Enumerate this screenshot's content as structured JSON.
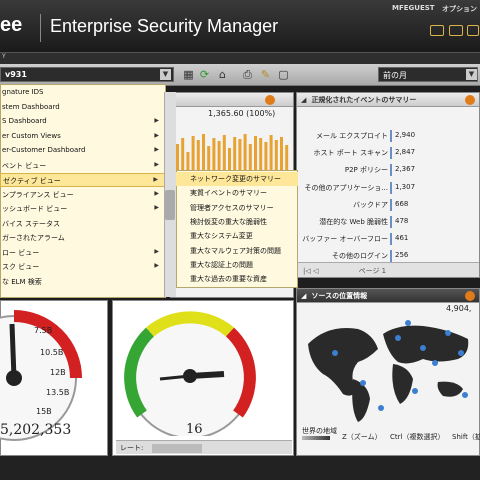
{
  "header": {
    "logo": "ee",
    "app_title": "Enterprise Security Manager",
    "user": "MFEGUEST",
    "options": "オプション"
  },
  "subbar": {
    "text": "Y"
  },
  "toolbar": {
    "device": "v931",
    "period": "前の月",
    "icons": [
      "grid-icon",
      "refresh-icon",
      "home-icon",
      "print-icon",
      "edit-icon",
      "window-icon"
    ]
  },
  "menu": {
    "items": [
      {
        "label": "gnature IDS",
        "has_sub": false
      },
      {
        "label": "stem Dashboard",
        "has_sub": false
      },
      {
        "label": "S Dashboard",
        "has_sub": true
      },
      {
        "label": "er Custom Views",
        "has_sub": true
      },
      {
        "label": "er-Customer Dashboard",
        "has_sub": true
      },
      {
        "label": "ベント ビュー",
        "has_sub": true
      },
      {
        "label": "ゼクティブ ビュー",
        "has_sub": true
      },
      {
        "label": "ンプライアンス ビュー",
        "has_sub": true
      },
      {
        "label": "ッシュボード ビュー",
        "has_sub": true
      },
      {
        "label": "バイス ステータス",
        "has_sub": false
      },
      {
        "label": "ガーされたアラーム",
        "has_sub": false
      },
      {
        "label": "ロー ビュー",
        "has_sub": true
      },
      {
        "label": "スク ビュー",
        "has_sub": true
      },
      {
        "label": "な ELM 検索",
        "has_sub": false
      }
    ],
    "selected_index": 6
  },
  "submenu": {
    "items": [
      "ネットワーク変更のサマリー",
      "実質イベントのサマリー",
      "管理者アクセスのサマリー",
      "検討仮変の重大な脆弱性",
      "重大なシステム変更",
      "重大なマルウェア対策の問題",
      "重大な認証上の問題",
      "重大な過去の重要な資産"
    ],
    "selected_index": 0
  },
  "chart_panel": {
    "value_label": "1,365.60 (100%)"
  },
  "events_panel": {
    "title": "正規化されたイベントのサマリー",
    "rows": [
      {
        "label": "メール エクスプロイト",
        "value": "2,940"
      },
      {
        "label": "ホスト ポート スキャン",
        "value": "2,847"
      },
      {
        "label": "P2P ポリシー",
        "value": "2,367"
      },
      {
        "label": "その他のアプリケーショ...",
        "value": "1,307"
      },
      {
        "label": "バックドア",
        "value": "668"
      },
      {
        "label": "潜在的な Web 脆弱性",
        "value": "478"
      },
      {
        "label": "バッファー オーバーフロー",
        "value": "461"
      },
      {
        "label": "その他のログイン",
        "value": "256"
      }
    ],
    "pager": "ページ 1"
  },
  "gauge1": {
    "reading": "5,202,353",
    "ticks": [
      "7.5B",
      "10.5B",
      "12B",
      "13.5B",
      "15B"
    ]
  },
  "gauge2": {
    "reading": "16",
    "rate_label": "レート:"
  },
  "map_panel": {
    "title": "ソースの位置情報",
    "count": "4,904,",
    "legend": "世界の地域",
    "hint_zoom": "Z（ズーム）",
    "hint_ctrl": "Ctrl（複数選択）",
    "hint_shift": "Shift（拡"
  }
}
